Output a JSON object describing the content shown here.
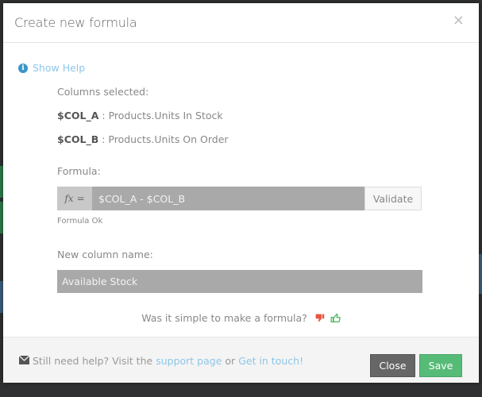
{
  "modal": {
    "title": "Create new formula",
    "close_symbol": "×"
  },
  "help": {
    "show_help_label": "Show Help",
    "icon": "info-icon"
  },
  "columns": {
    "label": "Columns selected:",
    "items": [
      {
        "var": "$COL_A",
        "sep": " : ",
        "name": "Products.Units In Stock"
      },
      {
        "var": "$COL_B",
        "sep": " : ",
        "name": "Products.Units On Order"
      }
    ]
  },
  "formula": {
    "label": "Formula:",
    "prefix_fx": "fx",
    "prefix_eq": "=",
    "value": "$COL_A - $COL_B",
    "validate_label": "Validate",
    "status": "Formula Ok"
  },
  "new_column": {
    "label": "New column name:",
    "value": "Available Stock"
  },
  "feedback": {
    "question": "Was it simple to make a formula?",
    "icons": [
      "thumbs-down-icon",
      "thumbs-up-icon"
    ],
    "down_color": "#e8553f",
    "up_color": "#4cb860"
  },
  "footer": {
    "help_prefix": "Still need help? Visit the",
    "support_link": "support page",
    "or": "or",
    "contact_link": "Get in touch!",
    "close_label": "Close",
    "save_label": "Save"
  }
}
